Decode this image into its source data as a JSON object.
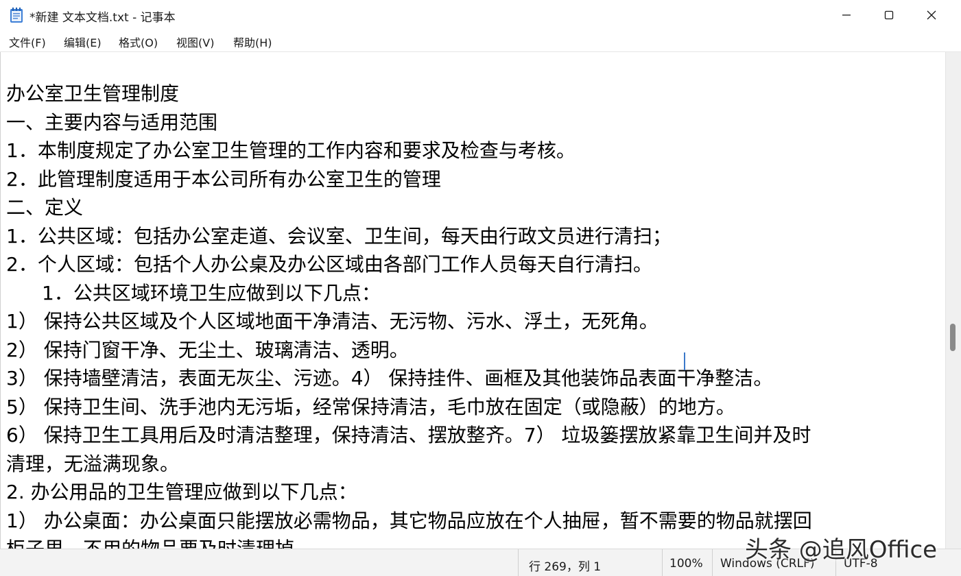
{
  "window": {
    "title": "*新建 文本文档.txt - 记事本",
    "icon": "notepad-icon",
    "controls": [
      "minimize-icon",
      "maximize-icon",
      "close-icon"
    ]
  },
  "menu": [
    {
      "label": "文件(F)"
    },
    {
      "label": "编辑(E)"
    },
    {
      "label": "格式(O)"
    },
    {
      "label": "视图(V)"
    },
    {
      "label": "帮助(H)"
    }
  ],
  "document": {
    "lines": [
      "办公室卫生管理制度",
      "一、主要内容与适用范围",
      "1．本制度规定了办公室卫生管理的工作内容和要求及检查与考核。",
      "2．此管理制度适用于本公司所有办公室卫生的管理",
      "二、定义",
      "1．公共区域：包括办公室走道、会议室、卫生间，每天由行政文员进行清扫；",
      "2．个人区域：包括个人办公桌及办公区域由各部门工作人员每天自行清扫。",
      "1．公共区域环境卫生应做到以下几点：",
      "1）  保持公共区域及个人区域地面干净清洁、无污物、污水、浮土，无死角。",
      "2）  保持门窗干净、无尘土、玻璃清洁、透明。",
      "3）  保持墙壁清洁，表面无灰尘、污迹。4）   保持挂件、画框及其他装饰品表面干净整洁。",
      "5）  保持卫生间、洗手池内无污垢，经常保持清洁，毛巾放在固定（或隐蔽）的地方。",
      "6）   保持卫生工具用后及时清洁整理，保持清洁、摆放整齐。7）   垃圾篓摆放紧靠卫生间并及时",
      "清理，无溢满现象。",
      "2. 办公用品的卫生管理应做到以下几点：",
      "1）  办公桌面：办公桌面只能摆放必需物品，其它物品应放在个人抽屉，暂不需要的物品就摆回",
      "柜子里，不用的物品要及时清理掉。"
    ]
  },
  "status": {
    "position": "行 269，列 1",
    "zoom": "100%",
    "line_ending": "Windows (CRLF)",
    "encoding": "UTF-8"
  },
  "watermark": {
    "text": "头条 @追风Office"
  },
  "colors": {
    "caret": "#3a78c9",
    "statusbar_bg": "#f3f3f3"
  }
}
